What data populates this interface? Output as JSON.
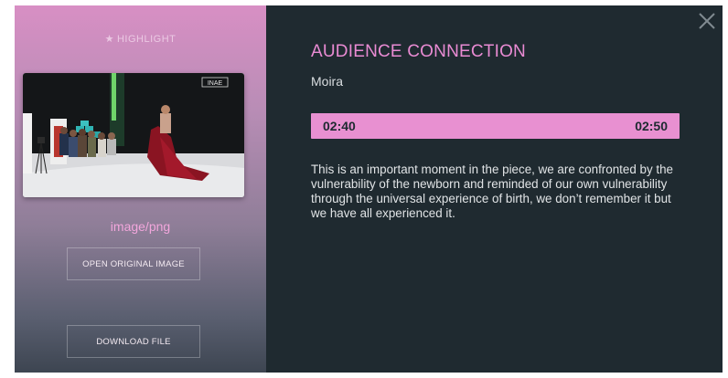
{
  "left": {
    "highlight_label": "HIGHLIGHT",
    "mime_type": "image/png",
    "open_button": "OPEN ORIGINAL IMAGE",
    "download_button": "DOWNLOAD FILE",
    "thumbnail_logo": "INAE"
  },
  "right": {
    "title": "AUDIENCE CONNECTION",
    "subtitle": "Moira",
    "time_start": "02:40",
    "time_end": "02:50",
    "description": "This is an important moment in the piece, we are confronted by the vulnerability of the newborn and reminded of our own vulnerability through the universal experience of birth, we don’t remember it but we have all experienced it."
  },
  "colors": {
    "accent": "#e890d1",
    "panel_dark": "#1f2a30"
  },
  "icons": {
    "star": "star-icon",
    "close": "close-icon"
  }
}
